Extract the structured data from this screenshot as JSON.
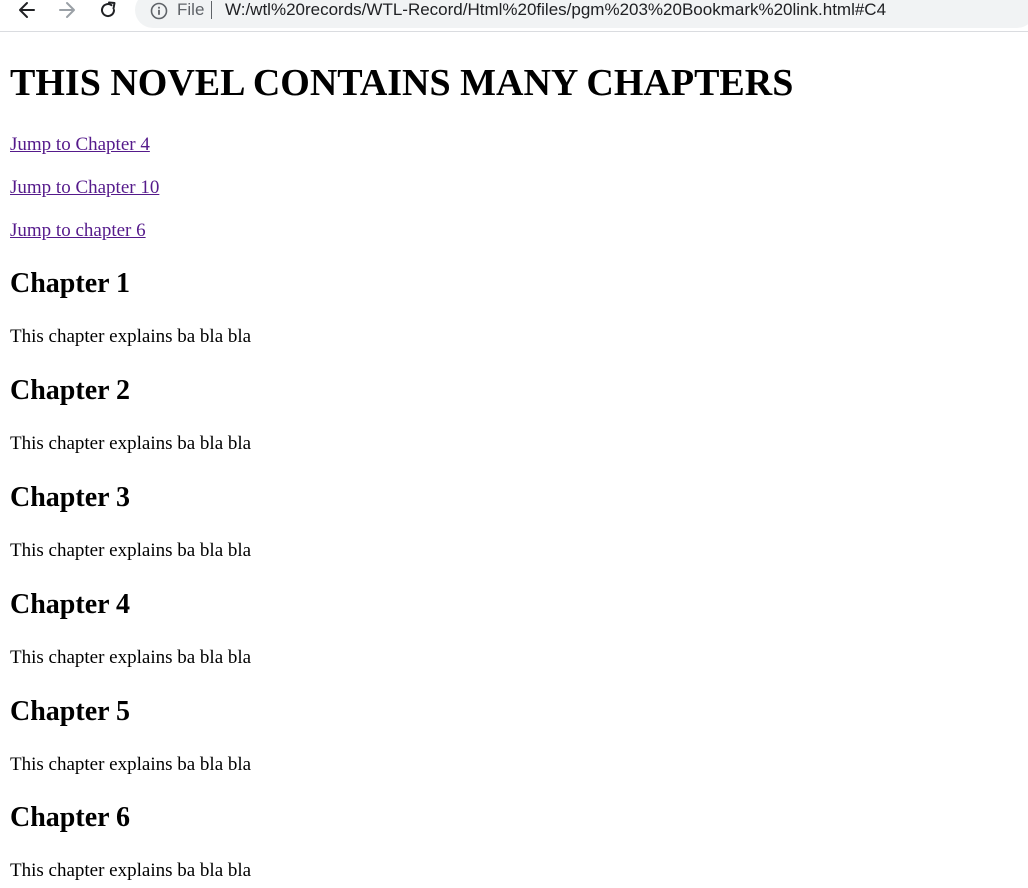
{
  "browser": {
    "scheme_label": "File",
    "url": "W:/wtl%20records/WTL-Record/Html%20files/pgm%203%20Bookmark%20link.html#C4"
  },
  "page": {
    "title": "THIS NOVEL CONTAINS MANY CHAPTERS",
    "links": [
      {
        "label": "Jump to Chapter 4"
      },
      {
        "label": "Jump to Chapter 10"
      },
      {
        "label": "Jump to chapter 6"
      }
    ],
    "chapters": [
      {
        "heading": "Chapter 1",
        "text": "This chapter explains ba bla bla"
      },
      {
        "heading": "Chapter 2",
        "text": "This chapter explains ba bla bla"
      },
      {
        "heading": "Chapter 3",
        "text": "This chapter explains ba bla bla"
      },
      {
        "heading": "Chapter 4",
        "text": "This chapter explains ba bla bla"
      },
      {
        "heading": "Chapter 5",
        "text": "This chapter explains ba bla bla"
      },
      {
        "heading": "Chapter 6",
        "text": "This chapter explains ba bla bla"
      }
    ]
  }
}
